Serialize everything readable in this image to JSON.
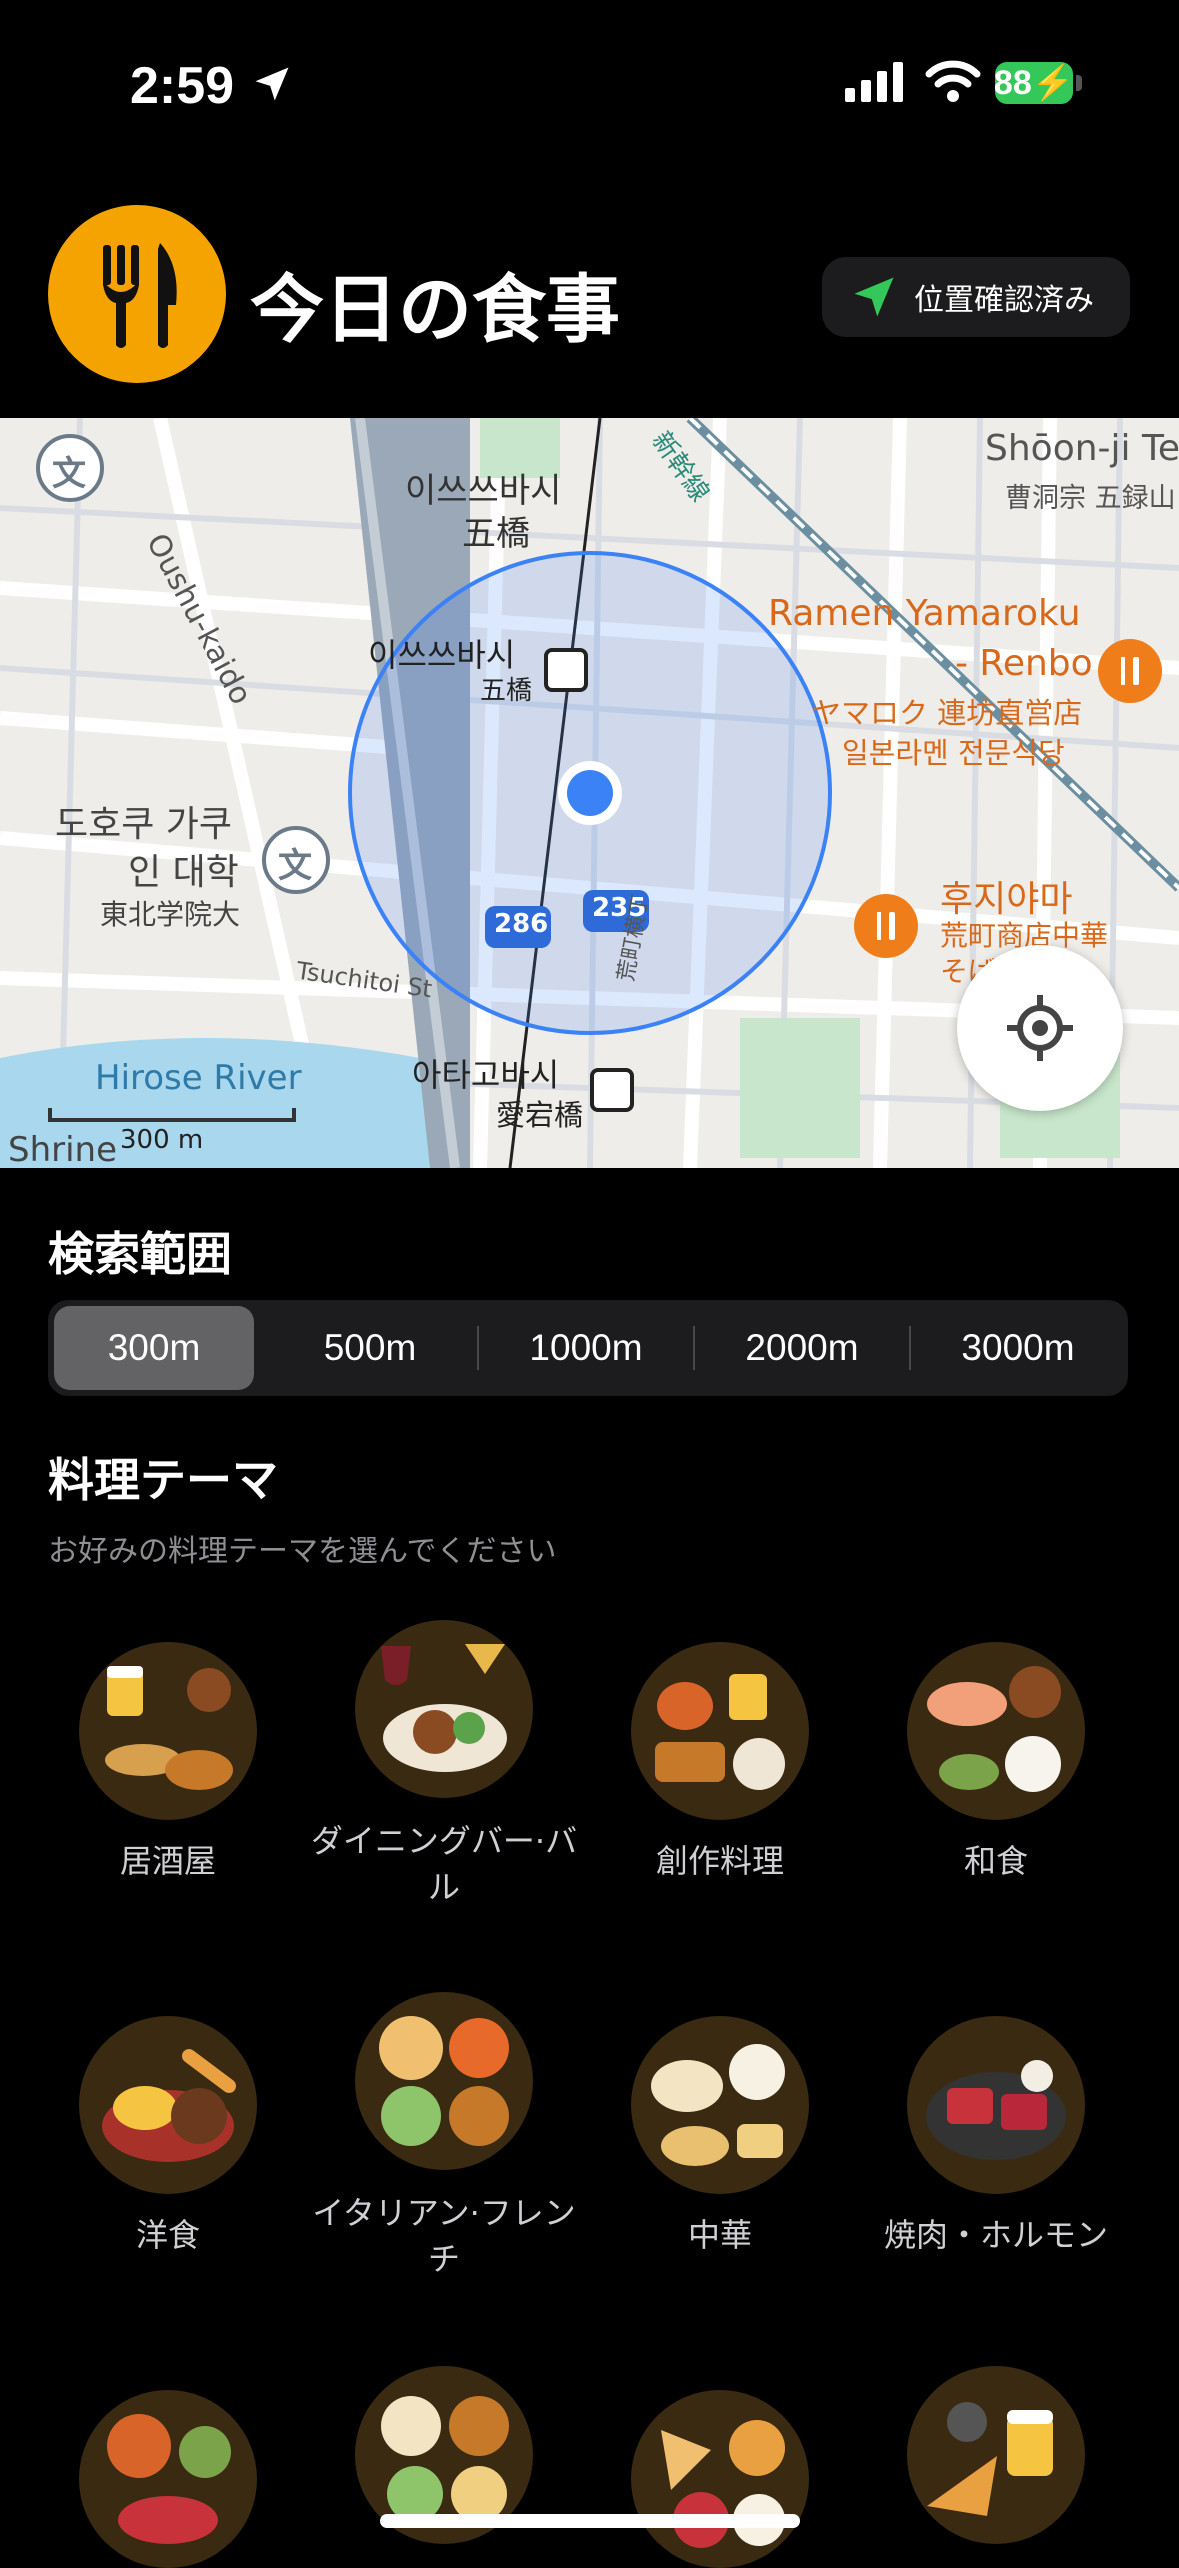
{
  "status_bar": {
    "time": "2:59",
    "battery": "88"
  },
  "header": {
    "title": "今日の食事",
    "location_chip": "位置確認済み"
  },
  "map": {
    "labels": {
      "street1": "Oushu-kaido",
      "station1_ko": "이쓰쓰바시",
      "station1_jp": "五橋",
      "station1b_ko": "이쓰쓰바시",
      "station1b_jp": "五橋",
      "shinkansen": "新幹線",
      "temple_en": "Shōon-ji Te",
      "temple_jp": "曹洞宗 五録山",
      "ramen_en1": "Ramen Yamaroku",
      "ramen_en2": "- Renbo",
      "ramen_jp": "ヤマロク 連坊直営店",
      "ramen_ko": "일본라멘 전문식당",
      "uni_ko1": "도호쿠 가쿠",
      "uni_ko2": "인 대학",
      "uni_jp": "東北学院大",
      "route286": "286",
      "route235": "235",
      "street2": "Tsuchitoi St",
      "street3": "荒町横丁",
      "fujiyama_ko": "후지야마",
      "fujiyama_jp": "荒町商店中華",
      "fujiyama_jp2": "そば",
      "river": "Hirose River",
      "station2_ko": "아타고바시",
      "station2_jp": "愛宕橋",
      "shrine": "Shrine",
      "scale": "300 m",
      "school_kanji": "文"
    }
  },
  "search_range": {
    "title": "検索範囲",
    "options": [
      "300m",
      "500m",
      "1000m",
      "2000m",
      "3000m"
    ],
    "selected": "300m"
  },
  "themes": {
    "title": "料理テーマ",
    "subtitle": "お好みの料理テーマを選んでください",
    "items": [
      {
        "label": "居酒屋"
      },
      {
        "label": "ダイニングバー·バル"
      },
      {
        "label": "創作料理"
      },
      {
        "label": "和食"
      },
      {
        "label": "洋食"
      },
      {
        "label": "イタリアン·フレンチ"
      },
      {
        "label": "中華"
      },
      {
        "label": "焼肉・ホルモン"
      }
    ]
  },
  "colors": {
    "accent_orange": "#f5a300",
    "map_pin": "#3b82f6",
    "green_arrow": "#34c759",
    "poi_orange": "#ef7d1a"
  }
}
